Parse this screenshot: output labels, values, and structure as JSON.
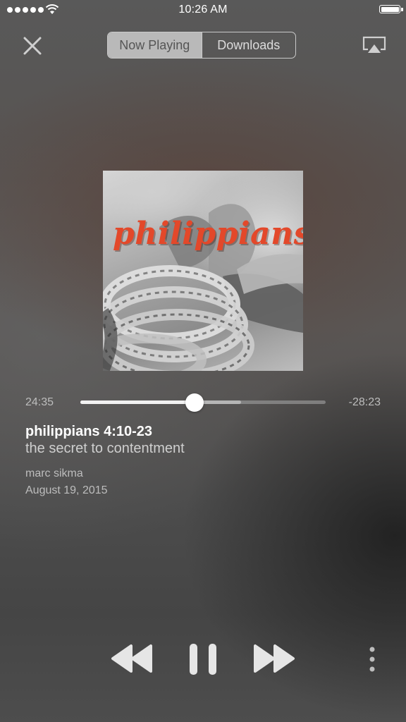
{
  "status_bar": {
    "time": "10:26 AM",
    "signal_icon": "signal-dots-icon",
    "wifi_icon": "wifi-icon",
    "battery_icon": "battery-icon"
  },
  "header": {
    "close_icon": "close-icon",
    "tabs": [
      {
        "label": "Now Playing",
        "active": true
      },
      {
        "label": "Downloads",
        "active": false
      }
    ],
    "airplay_icon": "airplay-icon"
  },
  "artwork": {
    "title_text": "philippians"
  },
  "player": {
    "elapsed": "24:35",
    "remaining": "-28:23",
    "progress": 0.465,
    "buffered": 0.655
  },
  "episode": {
    "title": "philippians 4:10-23",
    "subtitle": "the secret to contentment",
    "author": "marc sikma",
    "date": "August 19, 2015"
  },
  "controls": {
    "rewind_icon": "rewind-icon",
    "pause_icon": "pause-icon",
    "forward_icon": "fast-forward-icon",
    "more_icon": "more-vertical-icon"
  },
  "colors": {
    "artwork_title": "#e3482a",
    "text_primary": "#ffffff",
    "text_secondary": "#bdbdbd"
  }
}
